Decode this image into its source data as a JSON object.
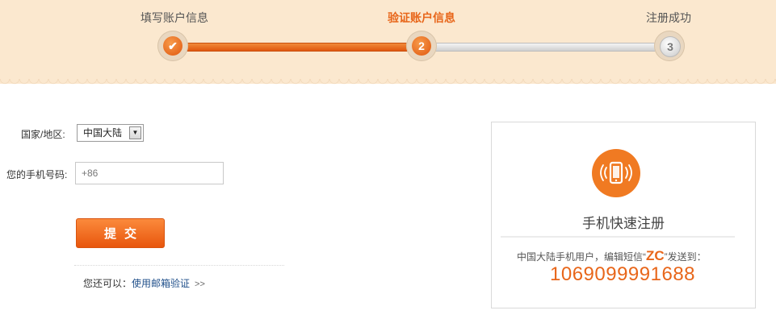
{
  "steps": {
    "items": [
      {
        "label": "填写账户信息",
        "marker": "✔",
        "state": "done"
      },
      {
        "label": "验证账户信息",
        "marker": "2",
        "state": "active"
      },
      {
        "label": "注册成功",
        "marker": "3",
        "state": "pending"
      }
    ]
  },
  "form": {
    "country_label": "国家/地区:",
    "country_value": "中国大陆",
    "phone_label": "您的手机号码:",
    "phone_value": "+86",
    "submit_label": "提交",
    "alt_prefix": "您还可以：",
    "alt_link": "使用邮箱验证",
    "alt_arrows": ">>"
  },
  "sms_card": {
    "icon": "mobile-phone-icon",
    "title": "手机快速注册",
    "instruction_prefix": "中国大陆手机用户，编辑短信“",
    "code": "ZC",
    "instruction_suffix": "”发送到：",
    "number": "1069099991688"
  },
  "colors": {
    "accent": "#e8661a",
    "band": "#fbe8cf",
    "link": "#1f4f8a"
  }
}
